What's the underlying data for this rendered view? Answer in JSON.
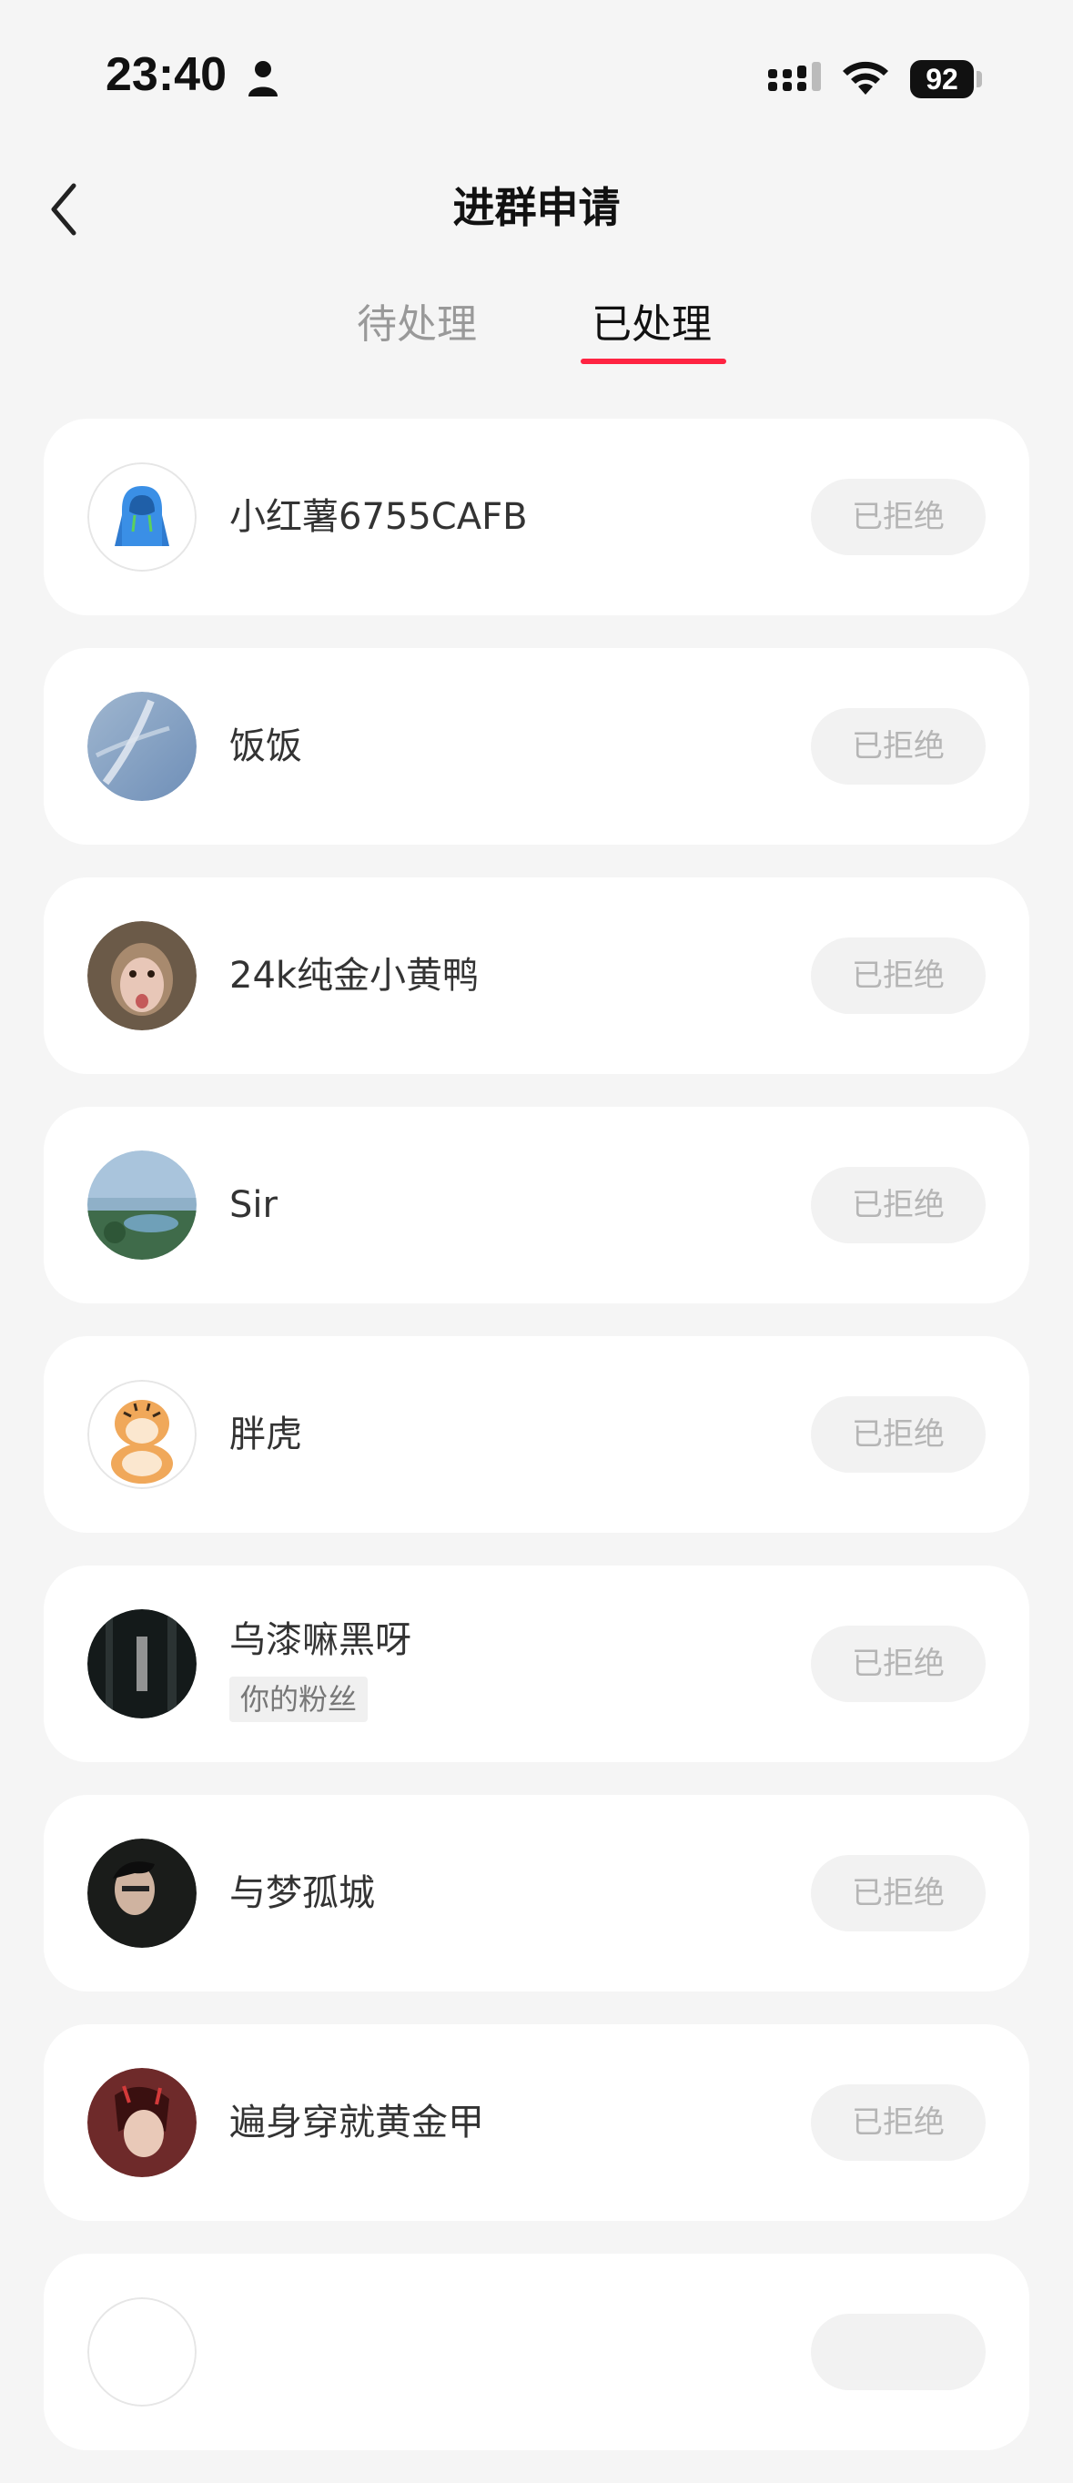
{
  "status_bar": {
    "time": "23:40",
    "battery": "92"
  },
  "header": {
    "title": "进群申请",
    "back_icon": "chevron-left-icon"
  },
  "tabs": [
    {
      "label": "待处理",
      "active": false
    },
    {
      "label": "已处理",
      "active": true
    }
  ],
  "accent_color": "#ff2442",
  "requests": [
    {
      "name": "小红薯6755CAFB",
      "tag": "",
      "status": "已拒绝"
    },
    {
      "name": "饭饭",
      "tag": "",
      "status": "已拒绝"
    },
    {
      "name": "24k纯金小黄鸭",
      "tag": "",
      "status": "已拒绝"
    },
    {
      "name": "Sir",
      "tag": "",
      "status": "已拒绝"
    },
    {
      "name": "胖虎",
      "tag": "",
      "status": "已拒绝"
    },
    {
      "name": "乌漆嘛黑呀",
      "tag": "你的粉丝",
      "status": "已拒绝"
    },
    {
      "name": "与梦孤城",
      "tag": "",
      "status": "已拒绝"
    },
    {
      "name": "遍身穿就黄金甲",
      "tag": "",
      "status": "已拒绝"
    },
    {
      "name": "",
      "tag": "",
      "status": ""
    }
  ]
}
